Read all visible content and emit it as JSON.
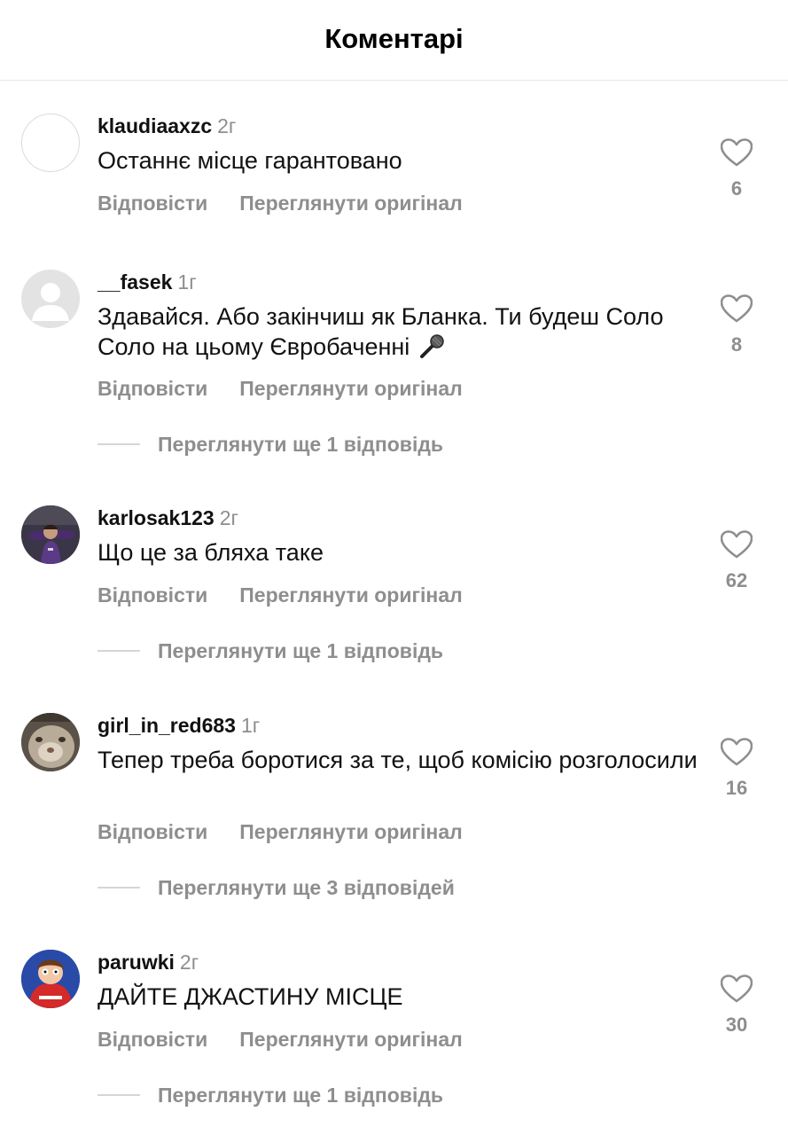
{
  "header": {
    "title": "Коментарі"
  },
  "actions": {
    "reply_label": "Відповісти",
    "translate_label": "Переглянути оригінал"
  },
  "comments": [
    {
      "username": "klaudiaaxzc",
      "time": "2г",
      "text": "Останнє місце гарантовано",
      "likes": "6",
      "avatar": "blank-avatar"
    },
    {
      "username": "__fasek",
      "time": "1г",
      "text": "Здавайся. Або закінчиш як Бланка. Ти будеш Соло Соло на цьому Євробаченні",
      "likes": "8",
      "avatar": "default-person-avatar",
      "more_replies": "Переглянути ще 1 відповідь"
    },
    {
      "username": "karlosak123",
      "time": "2г",
      "text": "Що це за бляха таке",
      "likes": "62",
      "avatar": "footballer-photo-avatar",
      "more_replies": "Переглянути ще 1 відповідь"
    },
    {
      "username": "girl_in_red683",
      "time": "1г",
      "text": "Тепер треба боротися за те, щоб комісію розголосили",
      "likes": "16",
      "avatar": "cat-photo-avatar",
      "more_replies": "Переглянути ще 3 відповідей"
    },
    {
      "username": "paruwki",
      "time": "2г",
      "text": "ДАЙТЕ ДЖАСТИНУ МІСЦЕ",
      "likes": "30",
      "avatar": "cartoon-character-avatar",
      "more_replies": "Переглянути ще 1 відповідь"
    }
  ],
  "colors": {
    "primary_text": "#111111",
    "secondary_text": "#8e8e8e",
    "divider": "#e6e6e6"
  }
}
